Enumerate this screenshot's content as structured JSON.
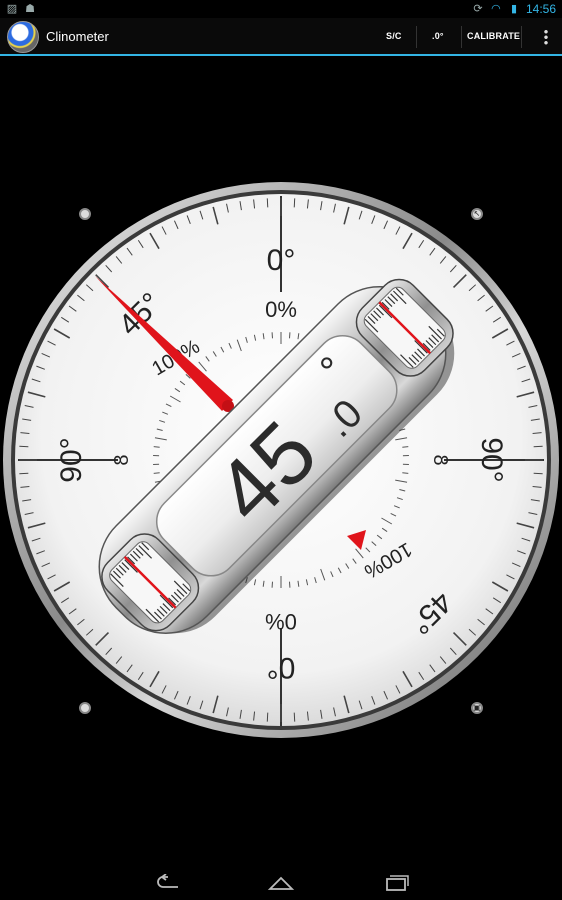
{
  "status_bar": {
    "time": "14:56",
    "left_icons": [
      "image-icon",
      "android-icon"
    ],
    "right_icons": [
      "rotate-icon",
      "wifi-icon",
      "battery-icon"
    ]
  },
  "app_bar": {
    "title": "Clinometer",
    "actions": {
      "sc": "S/C",
      "decimal": ".0°",
      "calibrate": "CALIBRATE"
    }
  },
  "gauge": {
    "reading_value": "45",
    "reading_decimal": ".0",
    "degree_symbol": "°",
    "outer_labels": {
      "top": "0°",
      "bottom": "0°",
      "left": "90°",
      "right": "90°",
      "upper_left": "45°",
      "lower_right": "45°"
    },
    "inner_labels": {
      "top_percent": "0%",
      "bottom_percent": "0%",
      "upper_left_percent": "100%",
      "lower_right_percent": "100%",
      "left_inf": "8",
      "right_inf": "8"
    },
    "needle_angle_deg": 45,
    "accent_color": "#e0141b"
  },
  "corner_buttons": [
    "lock-ring-icon",
    "arrow-icon",
    "lock-ring-icon",
    "lock-icon"
  ],
  "nav": {
    "icons": [
      "back-icon",
      "home-icon",
      "recent-apps-icon"
    ]
  }
}
